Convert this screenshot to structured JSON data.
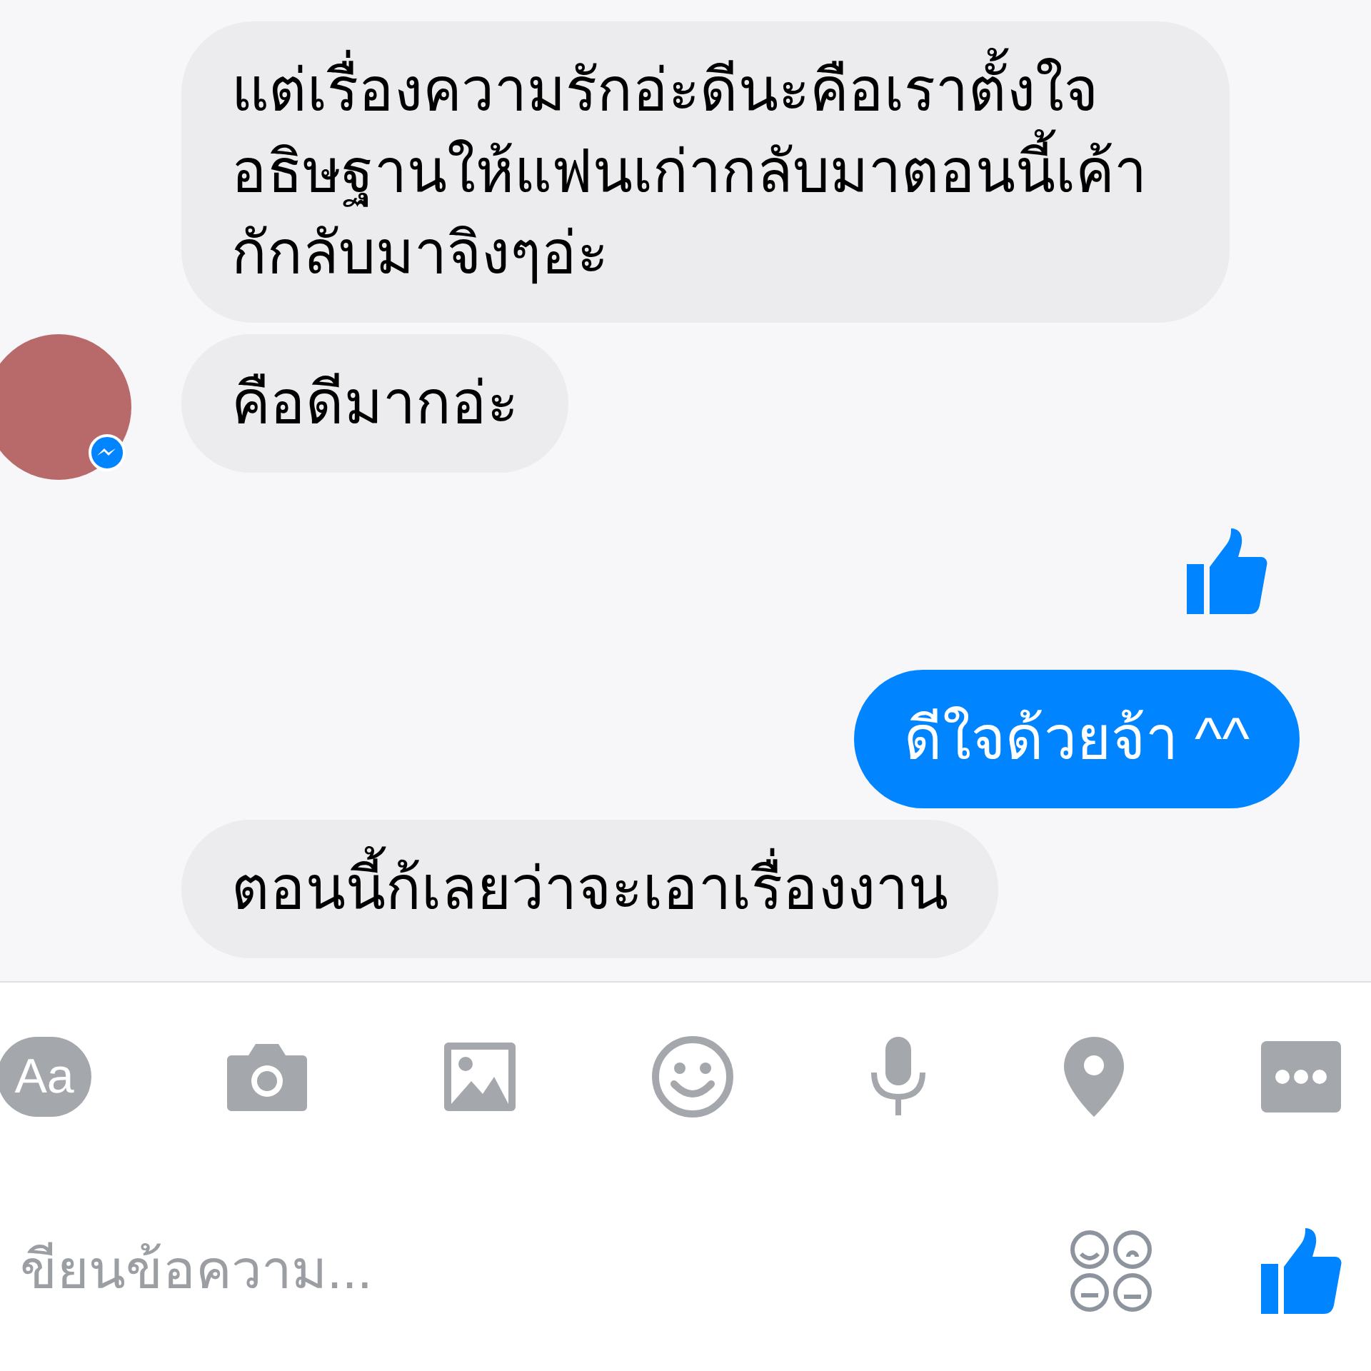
{
  "messages": [
    {
      "kind": "text",
      "sent": false,
      "show_avatar": false,
      "text": "แต่เรื่องความรักอ่ะดีนะคือเราตั้งใจอธิษฐานให้แฟนเก่ากลับมาตอนนี้เค้ากักลับมาจิงๆอ่ะ"
    },
    {
      "kind": "text",
      "sent": false,
      "show_avatar": true,
      "text": "คือดีมากอ่ะ"
    },
    {
      "kind": "like",
      "sent": true,
      "show_avatar": false
    },
    {
      "kind": "text",
      "sent": true,
      "show_avatar": false,
      "text": "ดีใจด้วยจ้า ^^"
    },
    {
      "kind": "text",
      "sent": false,
      "show_avatar": false,
      "text": "ตอนนี้ก้เลยว่าจะเอาเรื่องงาน"
    }
  ],
  "composer": {
    "aa_label": "Aa",
    "placeholder": "ขียนข้อความ..."
  }
}
